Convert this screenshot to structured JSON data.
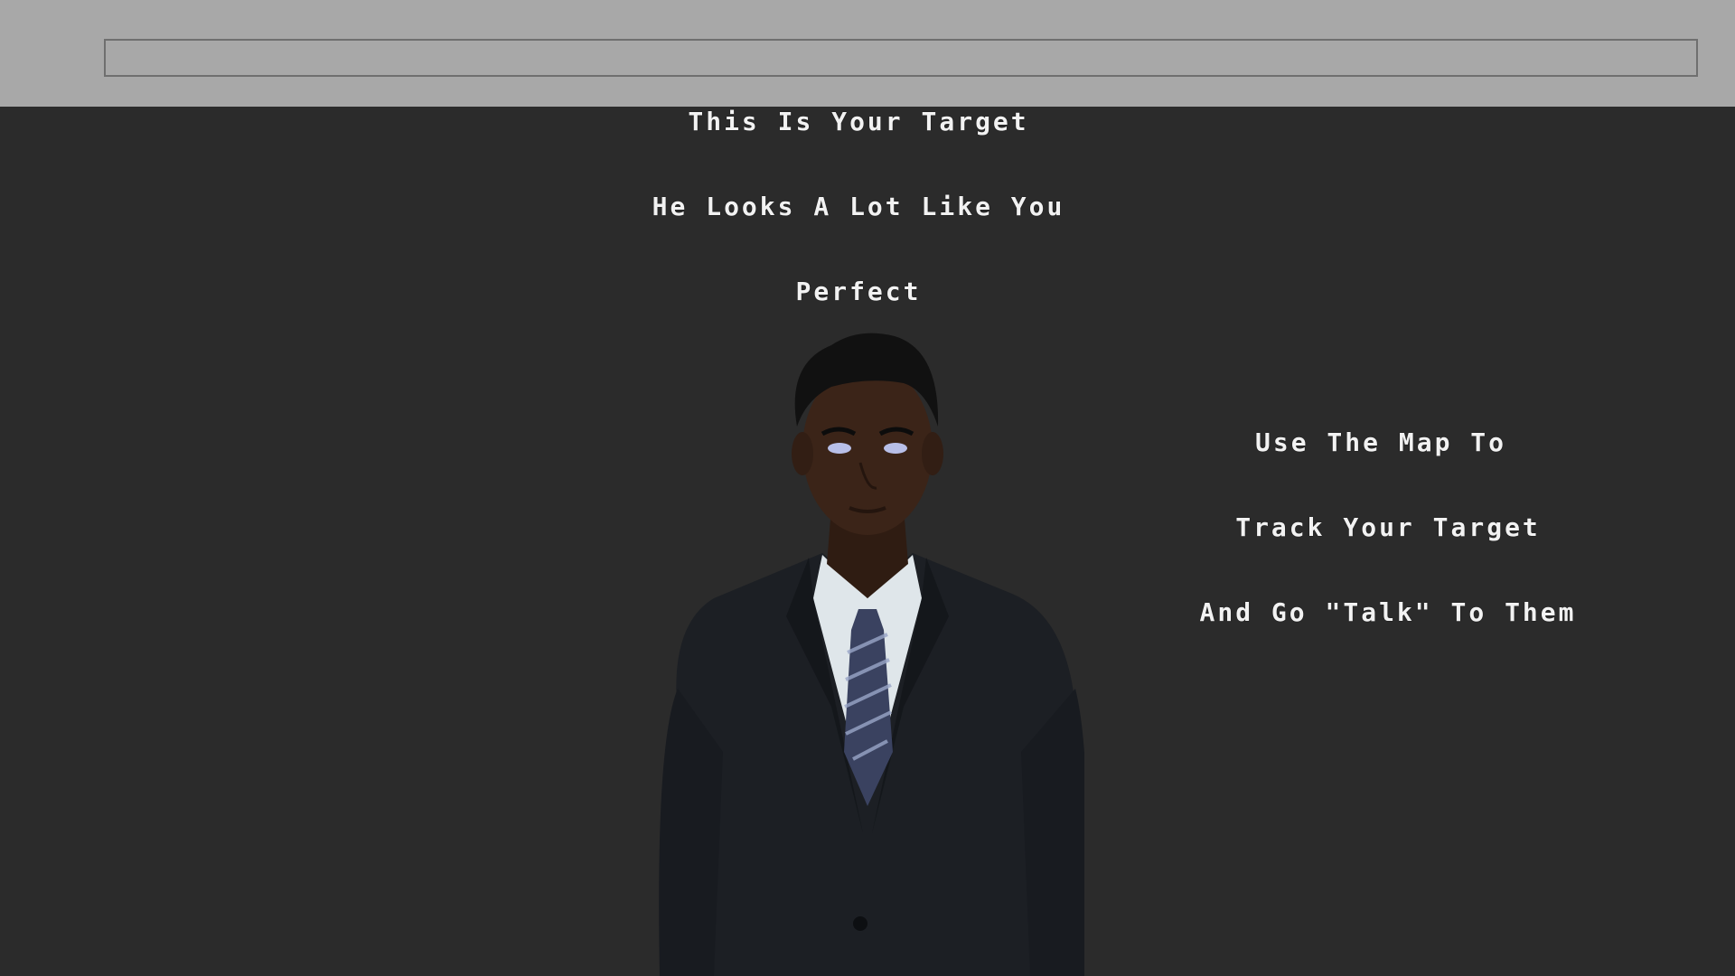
{
  "search_bar": {
    "value": "",
    "placeholder": ""
  },
  "dialogue": {
    "left_lines": [
      "This Is Your Target",
      "He Looks A Lot Like You",
      "Perfect"
    ],
    "right_lines": [
      "Use The Map To",
      "Track Your Target",
      "And Go \"Talk\" To Them"
    ]
  },
  "colors": {
    "top_bar": "#a8a8a8",
    "background": "#2b2b2b",
    "text": "#f2f2f2",
    "suit": "#1c1f24",
    "shirt": "#dfe6ea",
    "tie": "#3a4260",
    "skin": "#3b2418",
    "hair": "#111111"
  },
  "character": {
    "icon": "target-person-figure"
  }
}
